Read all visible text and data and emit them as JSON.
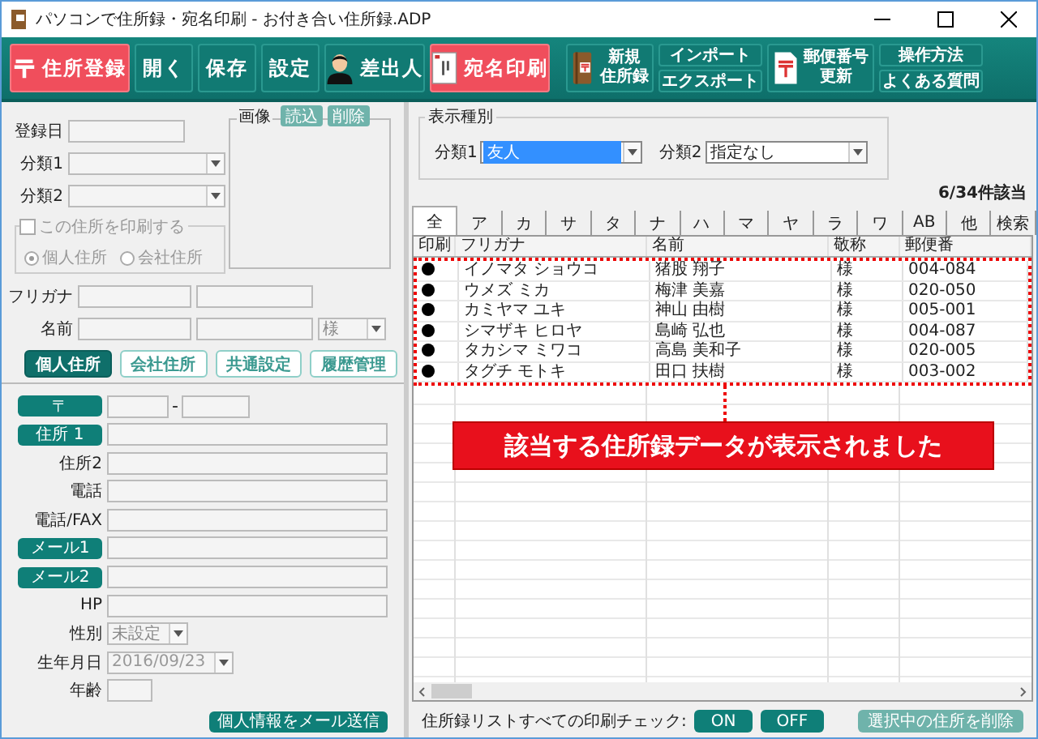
{
  "window": {
    "title": "パソコンで住所録・宛名印刷 - お付き合い住所録.ADP"
  },
  "toolbar": [
    {
      "kind": "mark",
      "labels": [
        "住所登録"
      ]
    },
    {
      "kind": "plain",
      "labels": [
        "開く"
      ]
    },
    {
      "kind": "plain",
      "labels": [
        "保存"
      ]
    },
    {
      "kind": "plain",
      "labels": [
        "設定"
      ]
    },
    {
      "kind": "person",
      "labels": [
        "差出人"
      ]
    },
    {
      "kind": "card",
      "labels": [
        "宛名印刷"
      ]
    },
    {
      "kind": "book",
      "labels": [
        "新規",
        "住所録"
      ]
    },
    {
      "kind": "pair",
      "labels": [
        "インポート",
        "エクスポート"
      ]
    },
    {
      "kind": "doc",
      "labels": [
        "郵便番号",
        "更新"
      ]
    },
    {
      "kind": "pair",
      "labels": [
        "操作方法",
        "よくある質問"
      ]
    }
  ],
  "record": {
    "date_label": "登録日",
    "category1_label": "分類1",
    "category2_label": "分類2",
    "image_label": "画像",
    "image_buttons": [
      "読込",
      "削除"
    ],
    "print_group": {
      "label": "この住所を印刷する",
      "checked": false,
      "disabled": true,
      "options": [
        {
          "label": "個人住所",
          "selected": true
        },
        {
          "label": "会社住所",
          "selected": false
        }
      ]
    },
    "furigana_label": "フリガナ",
    "name_label": "名前",
    "honorific": "様"
  },
  "detail_tabs": [
    {
      "label": "個人住所",
      "selected": true
    },
    {
      "label": "会社住所",
      "selected": false
    },
    {
      "label": "共通設定",
      "selected": false
    },
    {
      "label": "履歴管理",
      "selected": false
    }
  ],
  "postal": {
    "label": "〒",
    "separator": "-"
  },
  "fields": [
    {
      "kind": "button",
      "label": "住所 1"
    },
    {
      "kind": "text",
      "label": "住所2"
    },
    {
      "kind": "text",
      "label": "電話"
    },
    {
      "kind": "text",
      "label": "電話/FAX"
    },
    {
      "kind": "button",
      "label": "メール1"
    },
    {
      "kind": "button",
      "label": "メール2"
    },
    {
      "kind": "text",
      "label": "HP"
    }
  ],
  "gender": {
    "label": "性別",
    "value": "未設定"
  },
  "birthday": {
    "label": "生年月日",
    "value": "2016/09/23"
  },
  "age": {
    "label": "年齢"
  },
  "send_button": "個人情報をメール送信",
  "filter": {
    "title": "表示種別",
    "category1": {
      "label": "分類1",
      "value": "友人"
    },
    "category2": {
      "label": "分類2",
      "value": "指定なし"
    }
  },
  "count": "6/34件該当",
  "index_tabs": [
    {
      "label": "全",
      "selected": true
    },
    {
      "label": "ア",
      "selected": false
    },
    {
      "label": "カ",
      "selected": false
    },
    {
      "label": "サ",
      "selected": false
    },
    {
      "label": "タ",
      "selected": false
    },
    {
      "label": "ナ",
      "selected": false
    },
    {
      "label": "ハ",
      "selected": false
    },
    {
      "label": "マ",
      "selected": false
    },
    {
      "label": "ヤ",
      "selected": false
    },
    {
      "label": "ラ",
      "selected": false
    },
    {
      "label": "ワ",
      "selected": false
    },
    {
      "label": "AB",
      "selected": false
    },
    {
      "label": "他",
      "selected": false
    },
    {
      "label": "検索",
      "selected": false
    }
  ],
  "table": {
    "columns": [
      "印刷",
      "フリガナ",
      "名前",
      "敬称",
      "郵便番"
    ],
    "rows": [
      {
        "printed": true,
        "furigana": "イノマタ ショウコ",
        "name": "猪股 翔子",
        "honorific": "様",
        "postal": "004-084"
      },
      {
        "printed": true,
        "furigana": "ウメズ ミカ",
        "name": "梅津 美嘉",
        "honorific": "様",
        "postal": "020-050"
      },
      {
        "printed": true,
        "furigana": "カミヤマ ユキ",
        "name": "神山 由樹",
        "honorific": "様",
        "postal": "005-001"
      },
      {
        "printed": true,
        "furigana": "シマザキ ヒロヤ",
        "name": "島崎 弘也",
        "honorific": "様",
        "postal": "004-087"
      },
      {
        "printed": true,
        "furigana": "タカシマ ミワコ",
        "name": "高島 美和子",
        "honorific": "様",
        "postal": "020-005"
      },
      {
        "printed": true,
        "furigana": "タグチ モトキ",
        "name": "田口 扶樹",
        "honorific": "様",
        "postal": "003-002"
      }
    ]
  },
  "annotation": {
    "text": "該当する住所録データが表示されました"
  },
  "footer": {
    "label": "住所録リストすべての印刷チェック:",
    "on": "ON",
    "off": "OFF",
    "delete": "選択中の住所を削除",
    "delete_disabled": true
  }
}
